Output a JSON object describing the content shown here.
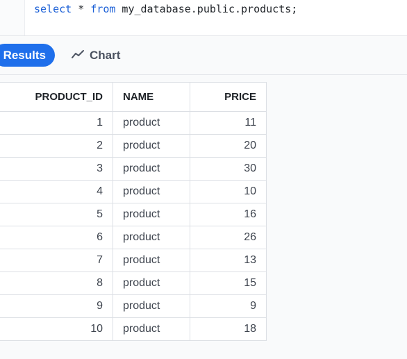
{
  "editor": {
    "sql": {
      "kw1": "select",
      "mid": " * ",
      "kw2": "from",
      "rest": " my_database.public.products;"
    }
  },
  "tabs": {
    "results_label": "Results",
    "chart_label": "Chart",
    "chart_icon": "trend-line-icon",
    "active": "results"
  },
  "table": {
    "columns": [
      "PRODUCT_ID",
      "NAME",
      "PRICE"
    ],
    "rows": [
      [
        "1",
        "product",
        "11"
      ],
      [
        "2",
        "product",
        "20"
      ],
      [
        "3",
        "product",
        "30"
      ],
      [
        "4",
        "product",
        "10"
      ],
      [
        "5",
        "product",
        "16"
      ],
      [
        "6",
        "product",
        "26"
      ],
      [
        "7",
        "product",
        "13"
      ],
      [
        "8",
        "product",
        "15"
      ],
      [
        "9",
        "product",
        "9"
      ],
      [
        "10",
        "product",
        "18"
      ]
    ]
  },
  "colors": {
    "accent": "#1f6feb",
    "keyword": "#1a5fd6"
  }
}
